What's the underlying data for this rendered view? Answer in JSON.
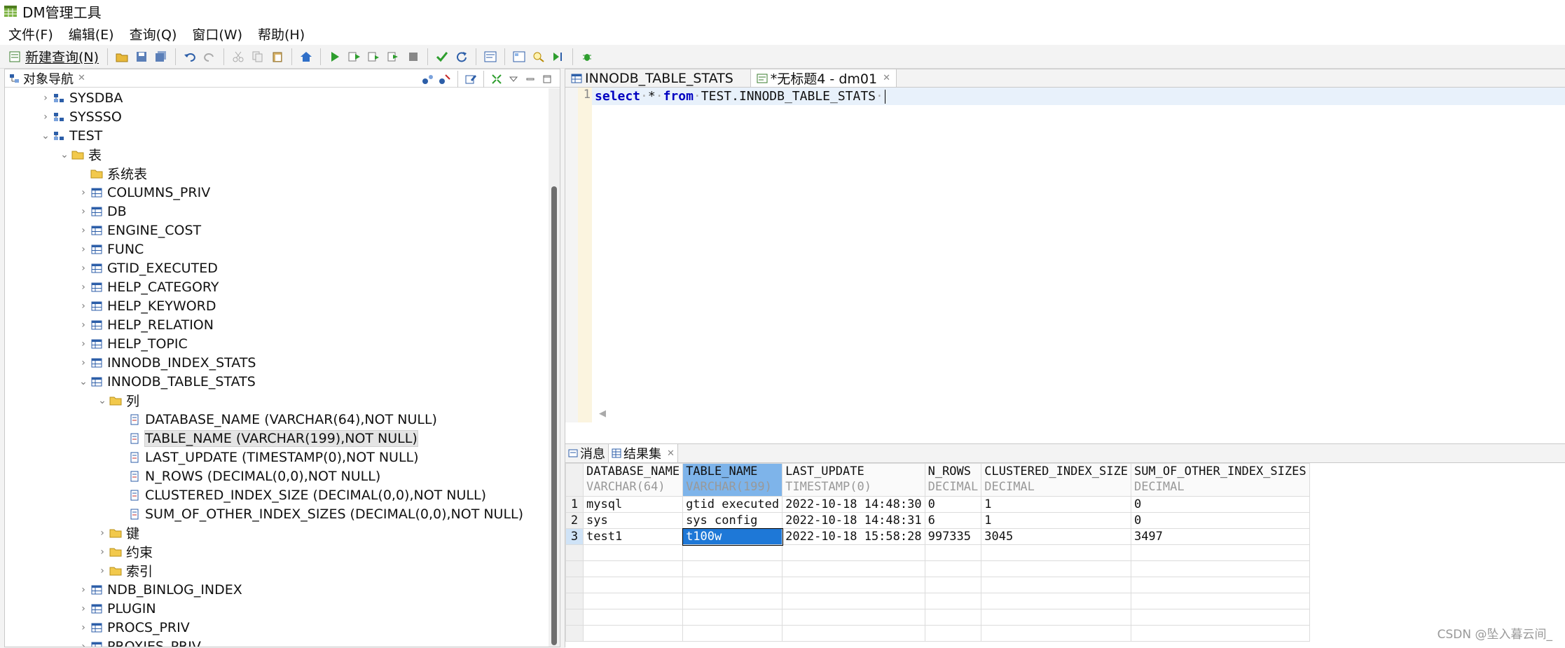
{
  "window": {
    "title": "DM管理工具"
  },
  "menu": [
    "文件(F)",
    "编辑(E)",
    "查询(Q)",
    "窗口(W)",
    "帮助(H)"
  ],
  "toolbar": {
    "new_query_label": "新建查询(N)"
  },
  "navigator": {
    "tab_label": "对象导航",
    "tree": [
      {
        "label": "SYSDBA",
        "depth": 2,
        "arrow": "›",
        "icon": "schema-icon"
      },
      {
        "label": "SYSSSO",
        "depth": 2,
        "arrow": "›",
        "icon": "schema-icon"
      },
      {
        "label": "TEST",
        "depth": 2,
        "arrow": "⌄",
        "icon": "schema-icon"
      },
      {
        "label": "表",
        "depth": 3,
        "arrow": "⌄",
        "icon": "folder-icon"
      },
      {
        "label": "系统表",
        "depth": 4,
        "arrow": "",
        "icon": "folder-icon"
      },
      {
        "label": "COLUMNS_PRIV",
        "depth": 4,
        "arrow": "›",
        "icon": "table-icon"
      },
      {
        "label": "DB",
        "depth": 4,
        "arrow": "›",
        "icon": "table-icon"
      },
      {
        "label": "ENGINE_COST",
        "depth": 4,
        "arrow": "›",
        "icon": "table-icon"
      },
      {
        "label": "FUNC",
        "depth": 4,
        "arrow": "›",
        "icon": "table-icon"
      },
      {
        "label": "GTID_EXECUTED",
        "depth": 4,
        "arrow": "›",
        "icon": "table-icon"
      },
      {
        "label": "HELP_CATEGORY",
        "depth": 4,
        "arrow": "›",
        "icon": "table-icon"
      },
      {
        "label": "HELP_KEYWORD",
        "depth": 4,
        "arrow": "›",
        "icon": "table-icon"
      },
      {
        "label": "HELP_RELATION",
        "depth": 4,
        "arrow": "›",
        "icon": "table-icon"
      },
      {
        "label": "HELP_TOPIC",
        "depth": 4,
        "arrow": "›",
        "icon": "table-icon"
      },
      {
        "label": "INNODB_INDEX_STATS",
        "depth": 4,
        "arrow": "›",
        "icon": "table-icon"
      },
      {
        "label": "INNODB_TABLE_STATS",
        "depth": 4,
        "arrow": "⌄",
        "icon": "table-icon"
      },
      {
        "label": "列",
        "depth": 5,
        "arrow": "⌄",
        "icon": "folder-icon"
      },
      {
        "label": "DATABASE_NAME (VARCHAR(64),NOT NULL)",
        "depth": 6,
        "arrow": "",
        "icon": "column-icon"
      },
      {
        "label": "TABLE_NAME (VARCHAR(199),NOT NULL)",
        "depth": 6,
        "arrow": "",
        "icon": "column-icon",
        "selected": true
      },
      {
        "label": "LAST_UPDATE (TIMESTAMP(0),NOT NULL)",
        "depth": 6,
        "arrow": "",
        "icon": "column-icon"
      },
      {
        "label": "N_ROWS (DECIMAL(0,0),NOT NULL)",
        "depth": 6,
        "arrow": "",
        "icon": "column-icon"
      },
      {
        "label": "CLUSTERED_INDEX_SIZE (DECIMAL(0,0),NOT NULL)",
        "depth": 6,
        "arrow": "",
        "icon": "column-icon"
      },
      {
        "label": "SUM_OF_OTHER_INDEX_SIZES (DECIMAL(0,0),NOT NULL)",
        "depth": 6,
        "arrow": "",
        "icon": "column-icon"
      },
      {
        "label": "键",
        "depth": 5,
        "arrow": "›",
        "icon": "folder-icon"
      },
      {
        "label": "约束",
        "depth": 5,
        "arrow": "›",
        "icon": "folder-icon"
      },
      {
        "label": "索引",
        "depth": 5,
        "arrow": "›",
        "icon": "folder-icon"
      },
      {
        "label": "NDB_BINLOG_INDEX",
        "depth": 4,
        "arrow": "›",
        "icon": "table-icon"
      },
      {
        "label": "PLUGIN",
        "depth": 4,
        "arrow": "›",
        "icon": "table-icon"
      },
      {
        "label": "PROCS_PRIV",
        "depth": 4,
        "arrow": "›",
        "icon": "table-icon"
      },
      {
        "label": "PROXIES_PRIV",
        "depth": 4,
        "arrow": "›",
        "icon": "table-icon"
      }
    ]
  },
  "editor": {
    "tabs": [
      {
        "label": "INNODB_TABLE_STATS",
        "active": false
      },
      {
        "label": "*无标题4 - dm01",
        "active": true
      }
    ],
    "line_number": "1",
    "code": {
      "kw1": "select",
      "star": "*",
      "kw2": "from",
      "rest": "TEST.INNODB_TABLE_STATS"
    }
  },
  "results": {
    "tabs": [
      {
        "label": "消息",
        "active": false
      },
      {
        "label": "结果集",
        "active": true
      }
    ],
    "columns": [
      {
        "name": "DATABASE_NAME",
        "type": "VARCHAR(64)"
      },
      {
        "name": "TABLE_NAME",
        "type": "VARCHAR(199)"
      },
      {
        "name": "LAST_UPDATE",
        "type": "TIMESTAMP(0)"
      },
      {
        "name": "N_ROWS",
        "type": "DECIMAL"
      },
      {
        "name": "CLUSTERED_INDEX_SIZE",
        "type": "DECIMAL"
      },
      {
        "name": "SUM_OF_OTHER_INDEX_SIZES",
        "type": "DECIMAL"
      }
    ],
    "rows": [
      [
        "1",
        "mysql",
        "gtid executed",
        "2022-10-18 14:48:30",
        "0",
        "1",
        "0"
      ],
      [
        "2",
        "sys",
        "sys config",
        "2022-10-18 14:48:31",
        "6",
        "1",
        "0"
      ],
      [
        "3",
        "test1",
        "t100w",
        "2022-10-18 15:58:28",
        "997335",
        "3045",
        "3497"
      ]
    ]
  },
  "watermark": "CSDN @坠入暮云间_"
}
